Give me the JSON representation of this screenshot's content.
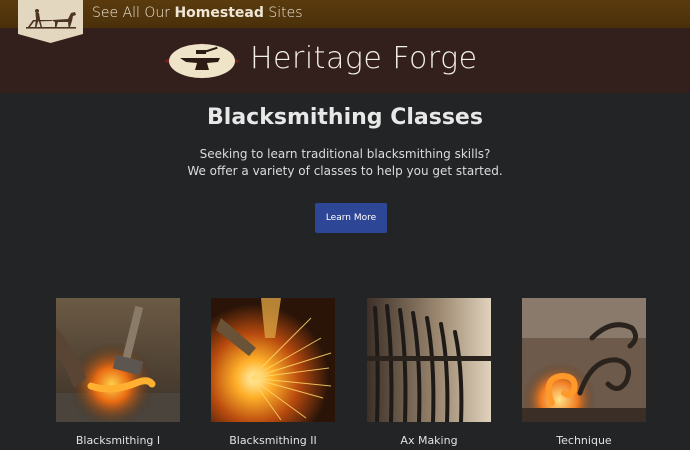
{
  "topbar": {
    "prefix": "See All Our ",
    "highlight": "Homestead",
    "suffix": " Sites",
    "logo_icon": "plow-horse-icon"
  },
  "brand": {
    "name": "Heritage Forge",
    "emblem_icon": "anvil-hammer-icon"
  },
  "hero": {
    "title": "Blacksmithing Classes",
    "line1": "Seeking to learn traditional blacksmithing skills?",
    "line2": "We offer a variety of classes to help you get started.",
    "button_label": "Learn More"
  },
  "classes": [
    {
      "label": "Blacksmithing I",
      "image": "hammer-on-hot-iron"
    },
    {
      "label": "Blacksmithing II",
      "image": "grinding-sparks"
    },
    {
      "label": "Ax Making",
      "image": "tongs-rack"
    },
    {
      "label": "Technique",
      "image": "scroll-in-fire"
    }
  ],
  "colors": {
    "topbar": "#5a3b0e",
    "brand_band": "#33201c",
    "background": "#222426",
    "button": "#2e4696"
  }
}
